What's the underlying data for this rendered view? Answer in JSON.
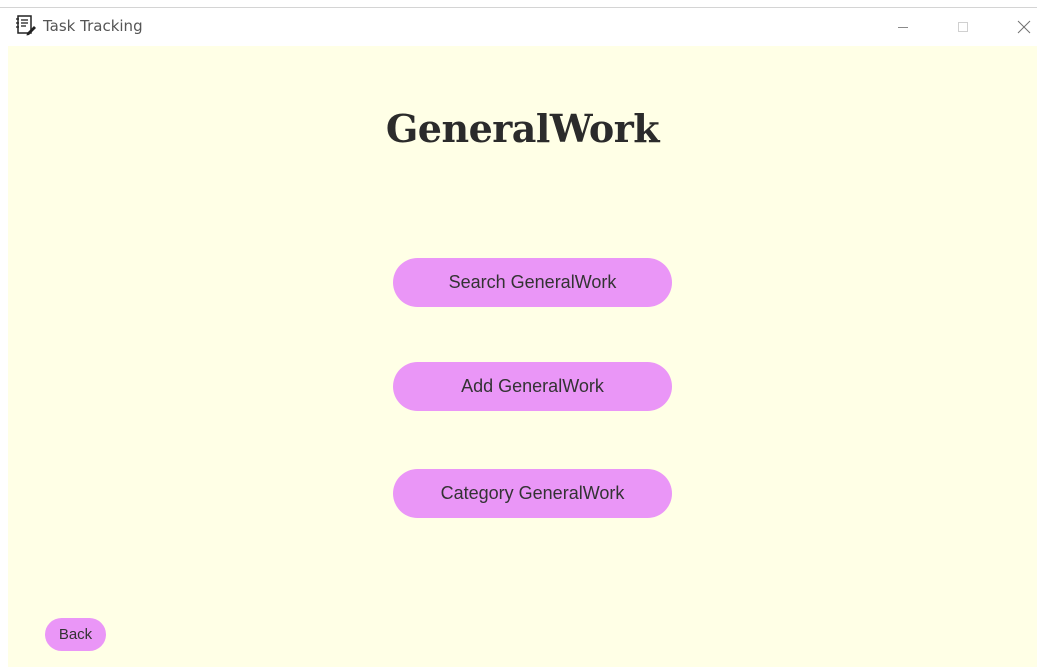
{
  "window": {
    "title": "Task Tracking",
    "icons": {
      "app": "notebook-pencil-icon",
      "minimize": "minimize-icon",
      "maximize": "maximize-icon",
      "close": "close-icon"
    }
  },
  "colors": {
    "background": "#ffffe6",
    "button": "#ea96f7",
    "title_text": "#2b2b2b"
  },
  "page": {
    "heading": "GeneralWork",
    "buttons": {
      "search": "Search GeneralWork",
      "add": "Add GeneralWork",
      "category": "Category GeneralWork"
    },
    "back": "Back"
  }
}
